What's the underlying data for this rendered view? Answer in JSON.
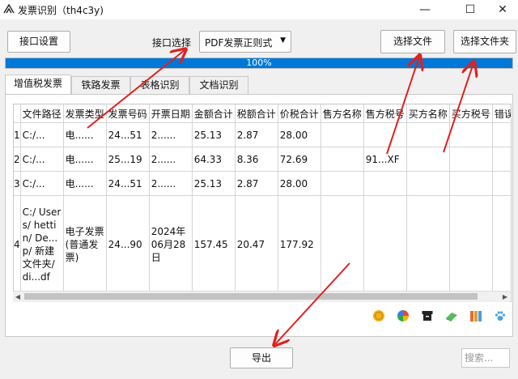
{
  "window": {
    "title": "发票识别（th4c3y)",
    "minimize": "—",
    "maximize": "☐",
    "close": "✕"
  },
  "toolbar": {
    "interface_settings": "接口设置",
    "interface_select_label": "接口选择",
    "interface_select_value": "PDF发票正则式",
    "select_file": "选择文件",
    "select_folder": "选择文件夹"
  },
  "progress": {
    "value": 1.0,
    "text": "100%"
  },
  "tabs": [
    "增值税发票",
    "铁路发票",
    "表格识别",
    "文档识别"
  ],
  "table": {
    "columns": [
      "文件路径",
      "发票类型",
      "发票号码",
      "开票日期",
      "金额合计",
      "税额合计",
      "价税合计",
      "售方名称",
      "售方税号",
      "买方名称",
      "买方税号",
      "错误信息"
    ],
    "rows": [
      {
        "no": "1",
        "cells": [
          "C:/...",
          "电......",
          "24...51",
          "2......",
          "25.13",
          "2.87",
          "28.00",
          "",
          "",
          "",
          "",
          ""
        ]
      },
      {
        "no": "2",
        "cells": [
          "C:/...",
          "电......",
          "25...19",
          "2......",
          "64.33",
          "8.36",
          "72.69",
          "",
          "91...XF",
          "",
          "",
          ""
        ]
      },
      {
        "no": "3",
        "cells": [
          "C:/...",
          "电......",
          "24...51",
          "2......",
          "25.13",
          "2.87",
          "28.00",
          "",
          "",
          "",
          "",
          ""
        ]
      },
      {
        "no": "4",
        "cells": [
          "C:/ Users/ hettin/ De...p/ 新建文件夹/ di...df",
          "电子发票(普通发票)",
          "24...90",
          "2024年06月28日",
          "157.45",
          "20.47",
          "177.92",
          "",
          "",
          "",
          "",
          ""
        ]
      }
    ]
  },
  "icons": [
    "coin-icon",
    "color-wheel-icon",
    "archive-box-icon",
    "book-icon",
    "folders-icon",
    "paw-icon"
  ],
  "export_button": "导出",
  "search": {
    "placeholder": "搜索..."
  },
  "colors": {
    "accent": "#0078d7",
    "arrow": "#e02020"
  }
}
